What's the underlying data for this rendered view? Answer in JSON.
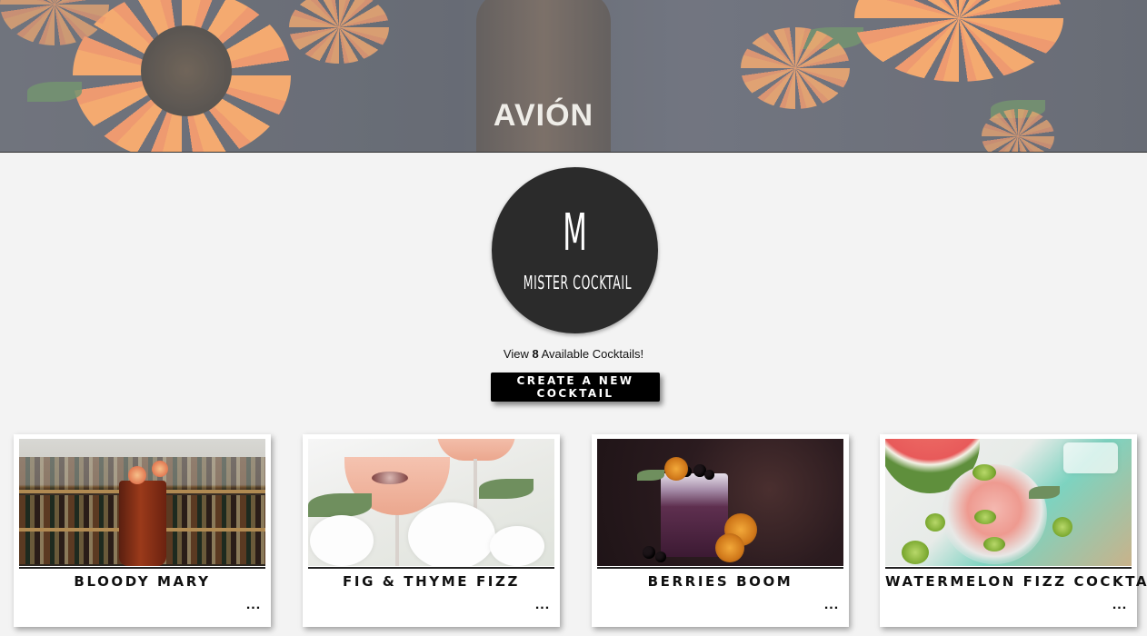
{
  "hero": {
    "bottle_label": "AVIÓN"
  },
  "logo": {
    "letter": "M",
    "name": "MISTER COCKTAIL"
  },
  "summary": {
    "prefix": "View ",
    "count": "8",
    "suffix": " Available Cocktails!"
  },
  "actions": {
    "create_label": "CREATE A NEW COCKTAIL"
  },
  "cards": [
    {
      "title": "BLOODY MARY",
      "more": "..."
    },
    {
      "title": "FIG & THYME FIZZ",
      "more": "..."
    },
    {
      "title": "BERRIES BOOM",
      "more": "..."
    },
    {
      "title": "WATERMELON FIZZ COCKTAIL",
      "more": "..."
    }
  ],
  "icons": {
    "more": "more-dots-icon"
  },
  "colors": {
    "background": "#f3f3f3",
    "logo": "#2b2b2b",
    "button": "#000000",
    "card": "#ffffff"
  }
}
